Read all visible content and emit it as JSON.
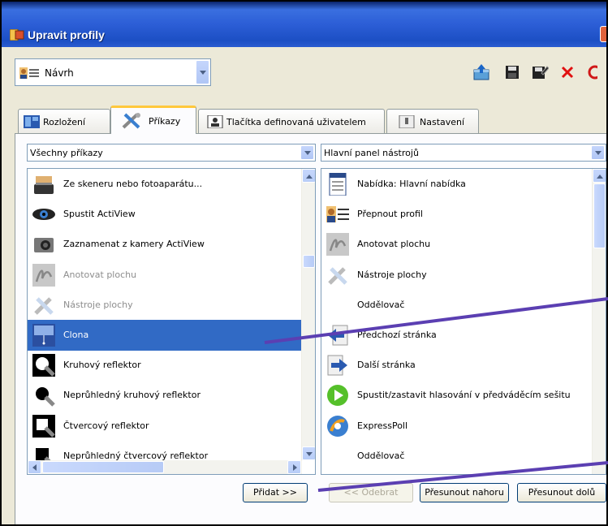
{
  "window": {
    "title": "Upravit profily",
    "close_color": "#e0623c",
    "title_color": "#2c5ed6"
  },
  "profile_select": {
    "value": "Návrh",
    "icon": "profile-card-icon"
  },
  "toolbar": {
    "buttons": [
      {
        "name": "export-profile-button",
        "icon": "export-icon"
      },
      {
        "name": "save-profile-button",
        "icon": "floppy-icon"
      },
      {
        "name": "save-as-profile-button",
        "icon": "floppy-edit-icon"
      },
      {
        "name": "delete-profile-button",
        "icon": "red-x-icon"
      },
      {
        "name": "refresh-profile-button",
        "icon": "refresh-icon"
      }
    ]
  },
  "tabs": [
    {
      "label": "Rozložení",
      "icon": "layout-icon",
      "active": false
    },
    {
      "label": "Příkazy",
      "icon": "tools-icon",
      "active": true
    },
    {
      "label": "Tlačítka definovaná uživatelem",
      "icon": "user-button-icon",
      "active": false
    },
    {
      "label": "Nastavení",
      "icon": "settings-icon",
      "active": false
    }
  ],
  "left_combo": {
    "value": "Všechny příkazy"
  },
  "right_combo": {
    "value": "Hlavní panel nástrojů"
  },
  "left_list": [
    {
      "label": "Ze skeneru nebo fotoaparátu...",
      "icon": "scanner-icon",
      "state": "normal"
    },
    {
      "label": "Spustit ActiView",
      "icon": "eye-icon",
      "state": "normal"
    },
    {
      "label": "Zaznamenat z kamery ActiView",
      "icon": "camera-icon",
      "state": "normal"
    },
    {
      "label": "Anotovat plochu",
      "icon": "annotate-icon",
      "state": "disabled"
    },
    {
      "label": "Nástroje plochy",
      "icon": "desktop-tools-icon",
      "state": "disabled"
    },
    {
      "label": "Clona",
      "icon": "blind-icon",
      "state": "selected"
    },
    {
      "label": "Kruhový reflektor",
      "icon": "spotlight-round-icon",
      "state": "normal"
    },
    {
      "label": "Neprůhledný kruhový reflektor",
      "icon": "spotlight-round-opaque-icon",
      "state": "normal"
    },
    {
      "label": "Čtvercový reflektor",
      "icon": "spotlight-square-icon",
      "state": "normal"
    },
    {
      "label": "Neprůhledný čtvercový reflektor",
      "icon": "spotlight-square-opaque-icon",
      "state": "normal"
    }
  ],
  "right_list": [
    {
      "label": "Nabídka: Hlavní nabídka",
      "icon": "menu-icon"
    },
    {
      "label": "Přepnout profil",
      "icon": "profile-card-icon"
    },
    {
      "label": "Anotovat plochu",
      "icon": "annotate-icon"
    },
    {
      "label": "Nástroje plochy",
      "icon": "desktop-tools-icon"
    },
    {
      "label": "Oddělovač",
      "icon": ""
    },
    {
      "label": "Předchozí stránka",
      "icon": "arrow-left-icon"
    },
    {
      "label": "Další stránka",
      "icon": "arrow-right-icon"
    },
    {
      "label": "Spustit/zastavit hlasování v předváděcím sešitu",
      "icon": "play-icon"
    },
    {
      "label": "ExpressPoll",
      "icon": "expresspoll-icon"
    },
    {
      "label": "Oddělovač",
      "icon": ""
    }
  ],
  "buttons": {
    "add": "Přidat >>",
    "remove": "<< Odebrat",
    "move_up": "Přesunout nahoru",
    "move_down": "Přesunout dolů"
  },
  "colors": {
    "selection": "#316ac5",
    "annotation_line": "#5b3fb2"
  }
}
